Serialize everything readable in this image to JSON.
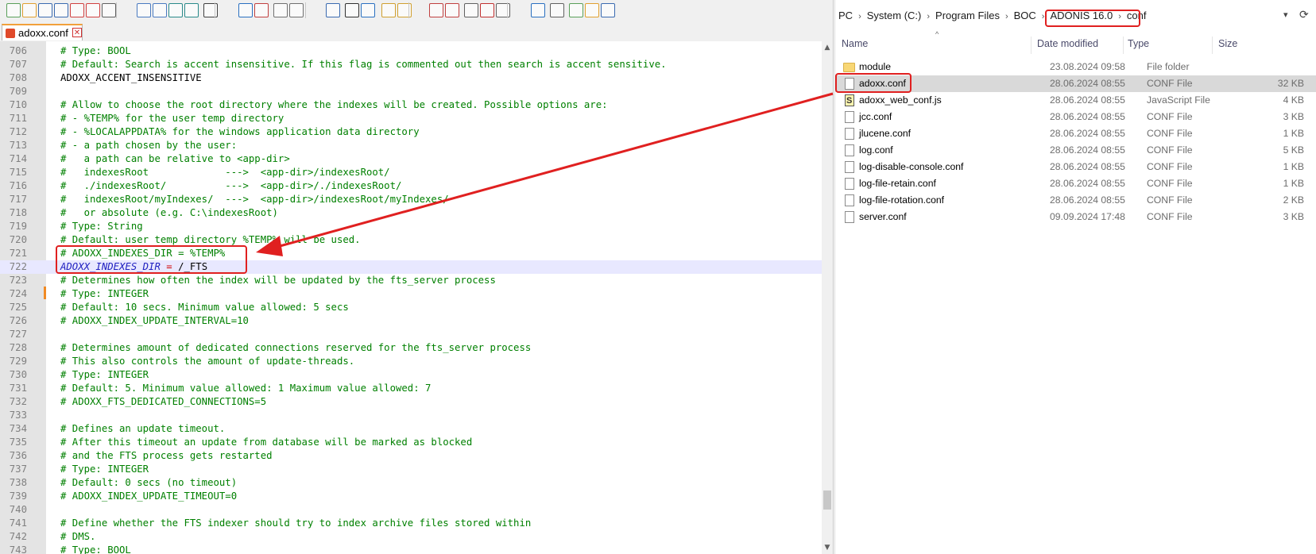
{
  "editor": {
    "tab": {
      "label": "adoxx.conf",
      "close": "✕"
    },
    "lines": [
      {
        "num": "706",
        "text": "# Type: BOOL"
      },
      {
        "num": "707",
        "text": "# Default: Search is accent insensitive. If this flag is commented out then search is accent sensitive."
      },
      {
        "num": "708",
        "text": "ADOXX_ACCENT_INSENSITIVE"
      },
      {
        "num": "709",
        "text": ""
      },
      {
        "num": "710",
        "text": "# Allow to choose the root directory where the indexes will be created. Possible options are:"
      },
      {
        "num": "711",
        "text": "# - %TEMP% for the user temp directory"
      },
      {
        "num": "712",
        "text": "# - %LOCALAPPDATA% for the windows application data directory"
      },
      {
        "num": "713",
        "text": "# - a path chosen by the user:"
      },
      {
        "num": "714",
        "text": "#   a path can be relative to <app-dir>"
      },
      {
        "num": "715",
        "text": "#   indexesRoot             --->  <app-dir>/indexesRoot/"
      },
      {
        "num": "716",
        "text": "#   ./indexesRoot/          --->  <app-dir>/./indexesRoot/"
      },
      {
        "num": "717",
        "text": "#   indexesRoot/myIndexes/  --->  <app-dir>/indexesRoot/myIndexes/"
      },
      {
        "num": "718",
        "text": "#   or absolute (e.g. C:\\indexesRoot)"
      },
      {
        "num": "719",
        "text": "# Type: String"
      },
      {
        "num": "720",
        "text": "# Default: user temp directory %TEMP% will be used."
      },
      {
        "num": "721",
        "text": "# ADOXX_INDEXES_DIR = %TEMP%"
      },
      {
        "num": "722",
        "key": "ADOXX_INDEXES_DIR",
        "op": " = ",
        "val": "/_FTS"
      },
      {
        "num": "723",
        "text": "# Determines how often the index will be updated by the fts_server process"
      },
      {
        "num": "724",
        "text": "# Type: INTEGER"
      },
      {
        "num": "725",
        "text": "# Default: 10 secs. Minimum value allowed: 5 secs"
      },
      {
        "num": "726",
        "text": "# ADOXX_INDEX_UPDATE_INTERVAL=10"
      },
      {
        "num": "727",
        "text": ""
      },
      {
        "num": "728",
        "text": "# Determines amount of dedicated connections reserved for the fts_server process"
      },
      {
        "num": "729",
        "text": "# This also controls the amount of update-threads."
      },
      {
        "num": "730",
        "text": "# Type: INTEGER"
      },
      {
        "num": "731",
        "text": "# Default: 5. Minimum value allowed: 1 Maximum value allowed: 7"
      },
      {
        "num": "732",
        "text": "# ADOXX_FTS_DEDICATED_CONNECTIONS=5"
      },
      {
        "num": "733",
        "text": ""
      },
      {
        "num": "734",
        "text": "# Defines an update timeout."
      },
      {
        "num": "735",
        "text": "# After this timeout an update from database will be marked as blocked"
      },
      {
        "num": "736",
        "text": "# and the FTS process gets restarted"
      },
      {
        "num": "737",
        "text": "# Type: INTEGER"
      },
      {
        "num": "738",
        "text": "# Default: 0 secs (no timeout)"
      },
      {
        "num": "739",
        "text": "# ADOXX_INDEX_UPDATE_TIMEOUT=0"
      },
      {
        "num": "740",
        "text": ""
      },
      {
        "num": "741",
        "text": "# Define whether the FTS indexer should try to index archive files stored within"
      },
      {
        "num": "742",
        "text": "# DMS."
      },
      {
        "num": "743",
        "text": "# Type: BOOL"
      }
    ],
    "scroll": {
      "up": "▲",
      "down": "▼"
    }
  },
  "explorer": {
    "breadcrumb": [
      "PC",
      "System (C:)",
      "Program Files",
      "BOC",
      "ADONIS 16.0",
      "conf"
    ],
    "sort_indicator": "^",
    "columns": {
      "name": "Name",
      "date": "Date modified",
      "type": "Type",
      "size": "Size"
    },
    "files": [
      {
        "name": "module",
        "date": "23.08.2024 09:58",
        "type": "File folder",
        "size": "",
        "icon": "folder"
      },
      {
        "name": "adoxx.conf",
        "date": "28.06.2024 08:55",
        "type": "CONF File",
        "size": "32 KB",
        "icon": "file",
        "selected": true
      },
      {
        "name": "adoxx_web_conf.js",
        "date": "28.06.2024 08:55",
        "type": "JavaScript File",
        "size": "4 KB",
        "icon": "js"
      },
      {
        "name": "jcc.conf",
        "date": "28.06.2024 08:55",
        "type": "CONF File",
        "size": "3 KB",
        "icon": "file"
      },
      {
        "name": "jlucene.conf",
        "date": "28.06.2024 08:55",
        "type": "CONF File",
        "size": "1 KB",
        "icon": "file"
      },
      {
        "name": "log.conf",
        "date": "28.06.2024 08:55",
        "type": "CONF File",
        "size": "5 KB",
        "icon": "file"
      },
      {
        "name": "log-disable-console.conf",
        "date": "28.06.2024 08:55",
        "type": "CONF File",
        "size": "1 KB",
        "icon": "file"
      },
      {
        "name": "log-file-retain.conf",
        "date": "28.06.2024 08:55",
        "type": "CONF File",
        "size": "1 KB",
        "icon": "file"
      },
      {
        "name": "log-file-rotation.conf",
        "date": "28.06.2024 08:55",
        "type": "CONF File",
        "size": "2 KB",
        "icon": "file"
      },
      {
        "name": "server.conf",
        "date": "09.09.2024 17:48",
        "type": "CONF File",
        "size": "3 KB",
        "icon": "file"
      }
    ]
  },
  "colors": {
    "annotation": "#e02020",
    "comment": "#008000",
    "current_line": "#e8e8ff"
  }
}
